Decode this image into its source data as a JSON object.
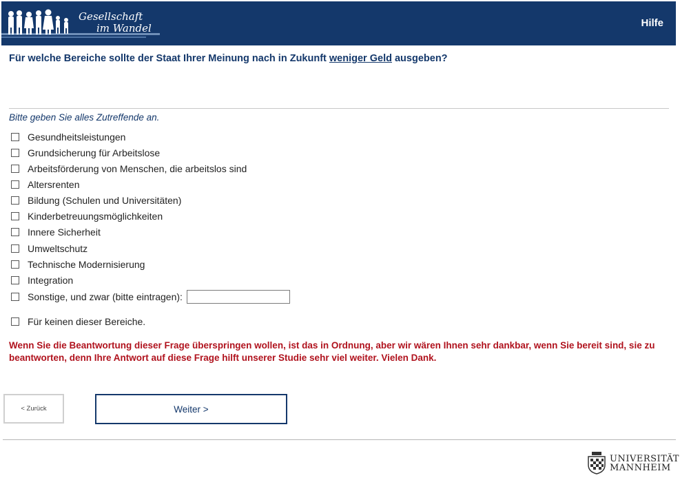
{
  "header": {
    "logo_line1": "Gesellschaft",
    "logo_line2": "im Wandel",
    "help_label": "Hilfe",
    "background_color": "#14386b"
  },
  "question": {
    "part1": "Für welche Bereiche sollte der Staat Ihrer Meinung nach in Zukunft ",
    "emphasis": "weniger Geld",
    "part2": " ausgeben?"
  },
  "instruction": "Bitte geben Sie alles Zutreffende an.",
  "options": [
    {
      "label": "Gesundheitsleistungen",
      "checked": false
    },
    {
      "label": "Grundsicherung für Arbeitslose",
      "checked": false
    },
    {
      "label": "Arbeitsförderung von Menschen, die arbeitslos sind",
      "checked": false
    },
    {
      "label": "Altersrenten",
      "checked": false
    },
    {
      "label": "Bildung (Schulen und Universitäten)",
      "checked": false
    },
    {
      "label": "Kinderbetreuungsmöglichkeiten",
      "checked": false
    },
    {
      "label": "Innere Sicherheit",
      "checked": false
    },
    {
      "label": "Umweltschutz",
      "checked": false
    },
    {
      "label": "Technische Modernisierung",
      "checked": false
    },
    {
      "label": "Integration",
      "checked": false
    }
  ],
  "other_option": {
    "label": "Sonstige, und zwar (bitte eintragen):",
    "value": ""
  },
  "none_option": {
    "label": "Für keinen dieser Bereiche.",
    "checked": false
  },
  "notice": "Wenn Sie die Beantwortung dieser Frage überspringen wollen, ist das in Ordnung, aber wir wären Ihnen sehr dankbar, wenn Sie bereit sind, sie zu beantworten, denn Ihre Antwort auf diese Frage hilft unserer Studie sehr viel weiter. Vielen Dank.",
  "buttons": {
    "back_label": "< Zurück",
    "next_label": "Weiter >"
  },
  "footer": {
    "university_line1": "UNIVERSITÄT",
    "university_line2": "MANNHEIM"
  },
  "colors": {
    "brand_blue": "#14386b",
    "notice_red": "#b0121d"
  }
}
